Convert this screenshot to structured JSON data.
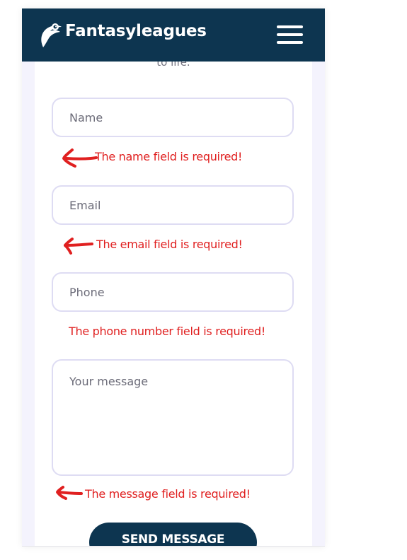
{
  "brand": {
    "name": "Fantasyleagues",
    "color": "#0d3550"
  },
  "intro": {
    "tail_text": "to life."
  },
  "form": {
    "name_placeholder": "Name",
    "email_placeholder": "Email",
    "phone_placeholder": "Phone",
    "message_placeholder": "Your message",
    "submit_label": "SEND MESSAGE"
  },
  "errors": {
    "name": "The name field is required!",
    "email": "The email field is required!",
    "phone": "The phone number field is required!",
    "message": "The message field is required!",
    "color": "#e02020"
  },
  "icons": {
    "logo": "fantasyleagues-logo-icon",
    "menu": "hamburger-menu-icon",
    "annotation": "red-arrow-icon"
  }
}
